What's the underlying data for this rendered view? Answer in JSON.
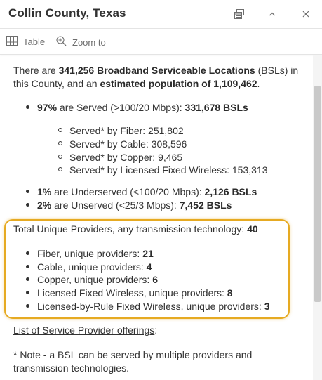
{
  "header": {
    "title": "Collin County, Texas"
  },
  "toolbar": {
    "table_label": "Table",
    "zoom_label": "Zoom to"
  },
  "intro": {
    "part1": "There are ",
    "bsl_bold": "341,256 Broadband Serviceable Locations",
    "part2": " (BSLs) in",
    "line2_part1": "this County, and an ",
    "pop_bold": "estimated population of 1,109,462",
    "line2_part2": "."
  },
  "served": {
    "pct": "97%",
    "text": " are Served (>100/20 Mbps): ",
    "count": "331,678 BSLs",
    "sub_items": [
      "Served* by Fiber: 251,802",
      "Served* by Cable: 308,596",
      "Served* by Copper: 9,465",
      "Served* by Licensed Fixed Wireless: 153,313"
    ]
  },
  "underserved": {
    "pct": "1%",
    "text": " are Underserved (<100/20 Mbps): ",
    "count": "2,126 BSLs"
  },
  "unserved": {
    "pct": "2%",
    "text": " are Unserved (<25/3 Mbps): ",
    "count": "7,452 BSLs"
  },
  "providers": {
    "total_text": "Total Unique Providers, any transmission technology: ",
    "total_count": "40",
    "items": [
      {
        "label": "Fiber, unique providers: ",
        "count": "21"
      },
      {
        "label": "Cable, unique providers: ",
        "count": "4"
      },
      {
        "label": "Copper, unique providers: ",
        "count": "6"
      },
      {
        "label": "Licensed Fixed Wireless, unique providers: ",
        "count": "8"
      },
      {
        "label": "Licensed-by-Rule Fixed Wireless, unique providers: ",
        "count": "3"
      }
    ]
  },
  "list_link": {
    "link_text": "List of Service Provider offerings",
    "suffix": ":"
  },
  "note": {
    "line1": "* Note - a BSL can be served by multiple providers and",
    "line2": "transmission technologies."
  },
  "colors": {
    "highlight": "#e6aa22",
    "text": "#323232"
  },
  "icons": [
    "dock-icon",
    "collapse-chevron-icon",
    "close-icon",
    "table-icon",
    "zoom-to-icon"
  ]
}
